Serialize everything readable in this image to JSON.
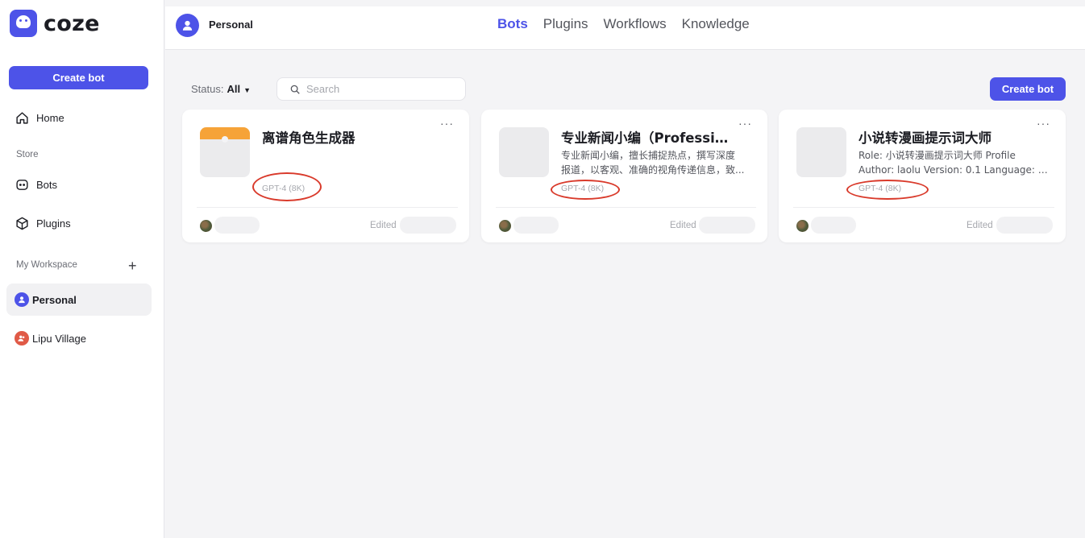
{
  "app": {
    "logo_text": "coze"
  },
  "sidebar": {
    "create_label": "Create bot",
    "home_label": "Home",
    "store_section": "Store",
    "store_items": [
      {
        "label": "Bots"
      },
      {
        "label": "Plugins"
      }
    ],
    "workspace_section": "My Workspace",
    "workspaces": [
      {
        "label": "Personal"
      },
      {
        "label": "Lipu Village"
      }
    ]
  },
  "header": {
    "workspace_name": "Personal",
    "tabs": [
      {
        "label": "Bots"
      },
      {
        "label": "Plugins"
      },
      {
        "label": "Workflows"
      },
      {
        "label": "Knowledge"
      }
    ],
    "active_tab": "Bots"
  },
  "filters": {
    "status_label": "Status:",
    "status_value": "All",
    "search_placeholder": "Search",
    "create_label": "Create bot"
  },
  "cards": [
    {
      "title": "离谱角色生成器",
      "desc_lines": [
        "",
        ""
      ],
      "model": "GPT-4 (8K)",
      "edited_label": "Edited"
    },
    {
      "title": "专业新闻小编（Profession...",
      "desc_lines": [
        "专业新闻小编，擅长捕捉热点，撰写深度",
        "报道，以客观、准确的视角传递信息，致..."
      ],
      "model": "GPT-4 (8K)",
      "edited_label": "Edited"
    },
    {
      "title": "小说转漫画提示词大师",
      "desc_lines": [
        "Role: 小说转漫画提示词大师 Profile",
        "Author: laolu Version: 0.1 Language: 中..."
      ],
      "model": "GPT-4 (8K)",
      "edited_label": "Edited"
    }
  ],
  "colors": {
    "accent": "#4d53e8",
    "annotation": "#d93a2b",
    "workspace_alt": "#e05a47"
  }
}
